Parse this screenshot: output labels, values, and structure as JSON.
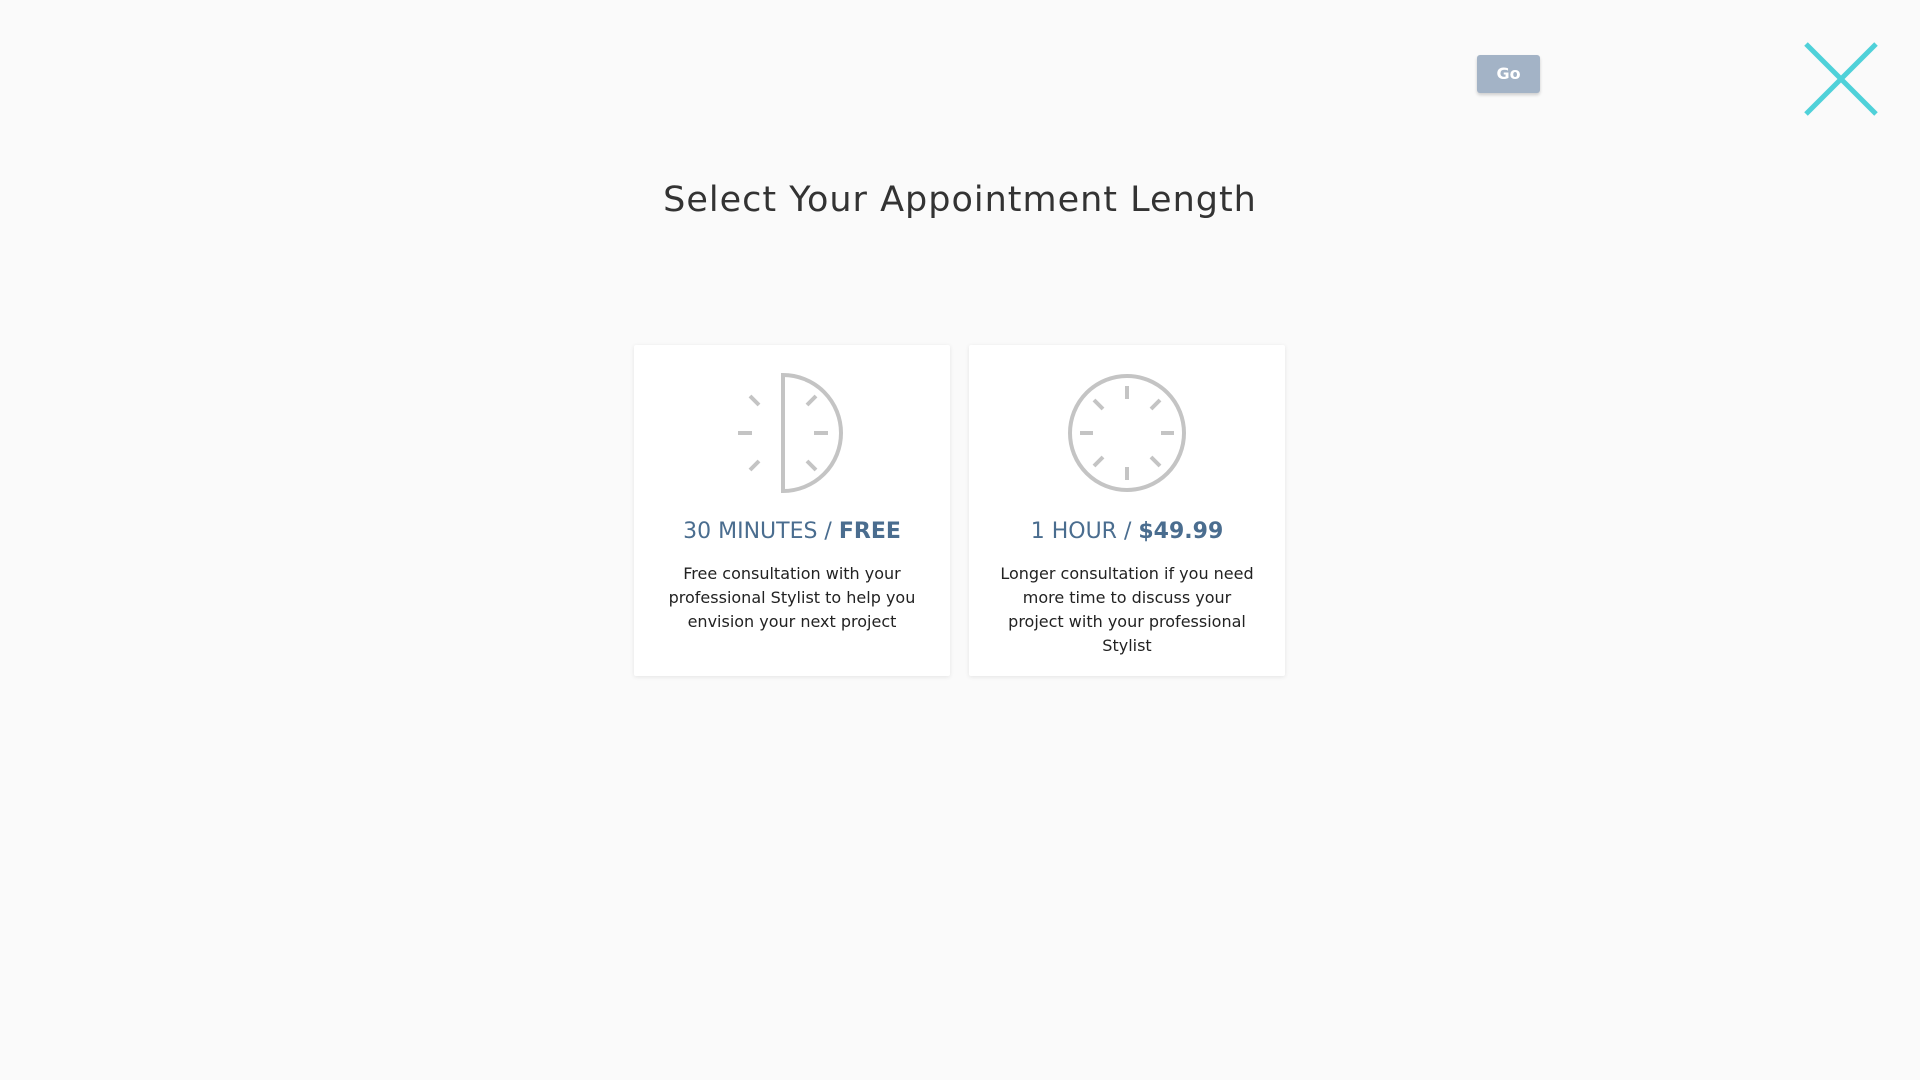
{
  "header": {
    "go_label": "Go",
    "close_icon": "close-icon"
  },
  "page": {
    "title": "Select Your Appointment Length"
  },
  "options": [
    {
      "icon": "half-clock-icon",
      "duration": "30 MINUTES /",
      "price": "FREE",
      "description": "Free consultation with your professional Stylist to help you envision your next project"
    },
    {
      "icon": "full-clock-icon",
      "duration": "1 HOUR /",
      "price": "$49.99",
      "description": "Longer consultation if you need more time to discuss your project with your professional Stylist"
    }
  ],
  "colors": {
    "background": "#fafafa",
    "go_button": "#a3b3c6",
    "close_accent": "#4fd1d9",
    "option_title": "#4a6d8f",
    "icon_stroke": "#c4c4c4"
  }
}
